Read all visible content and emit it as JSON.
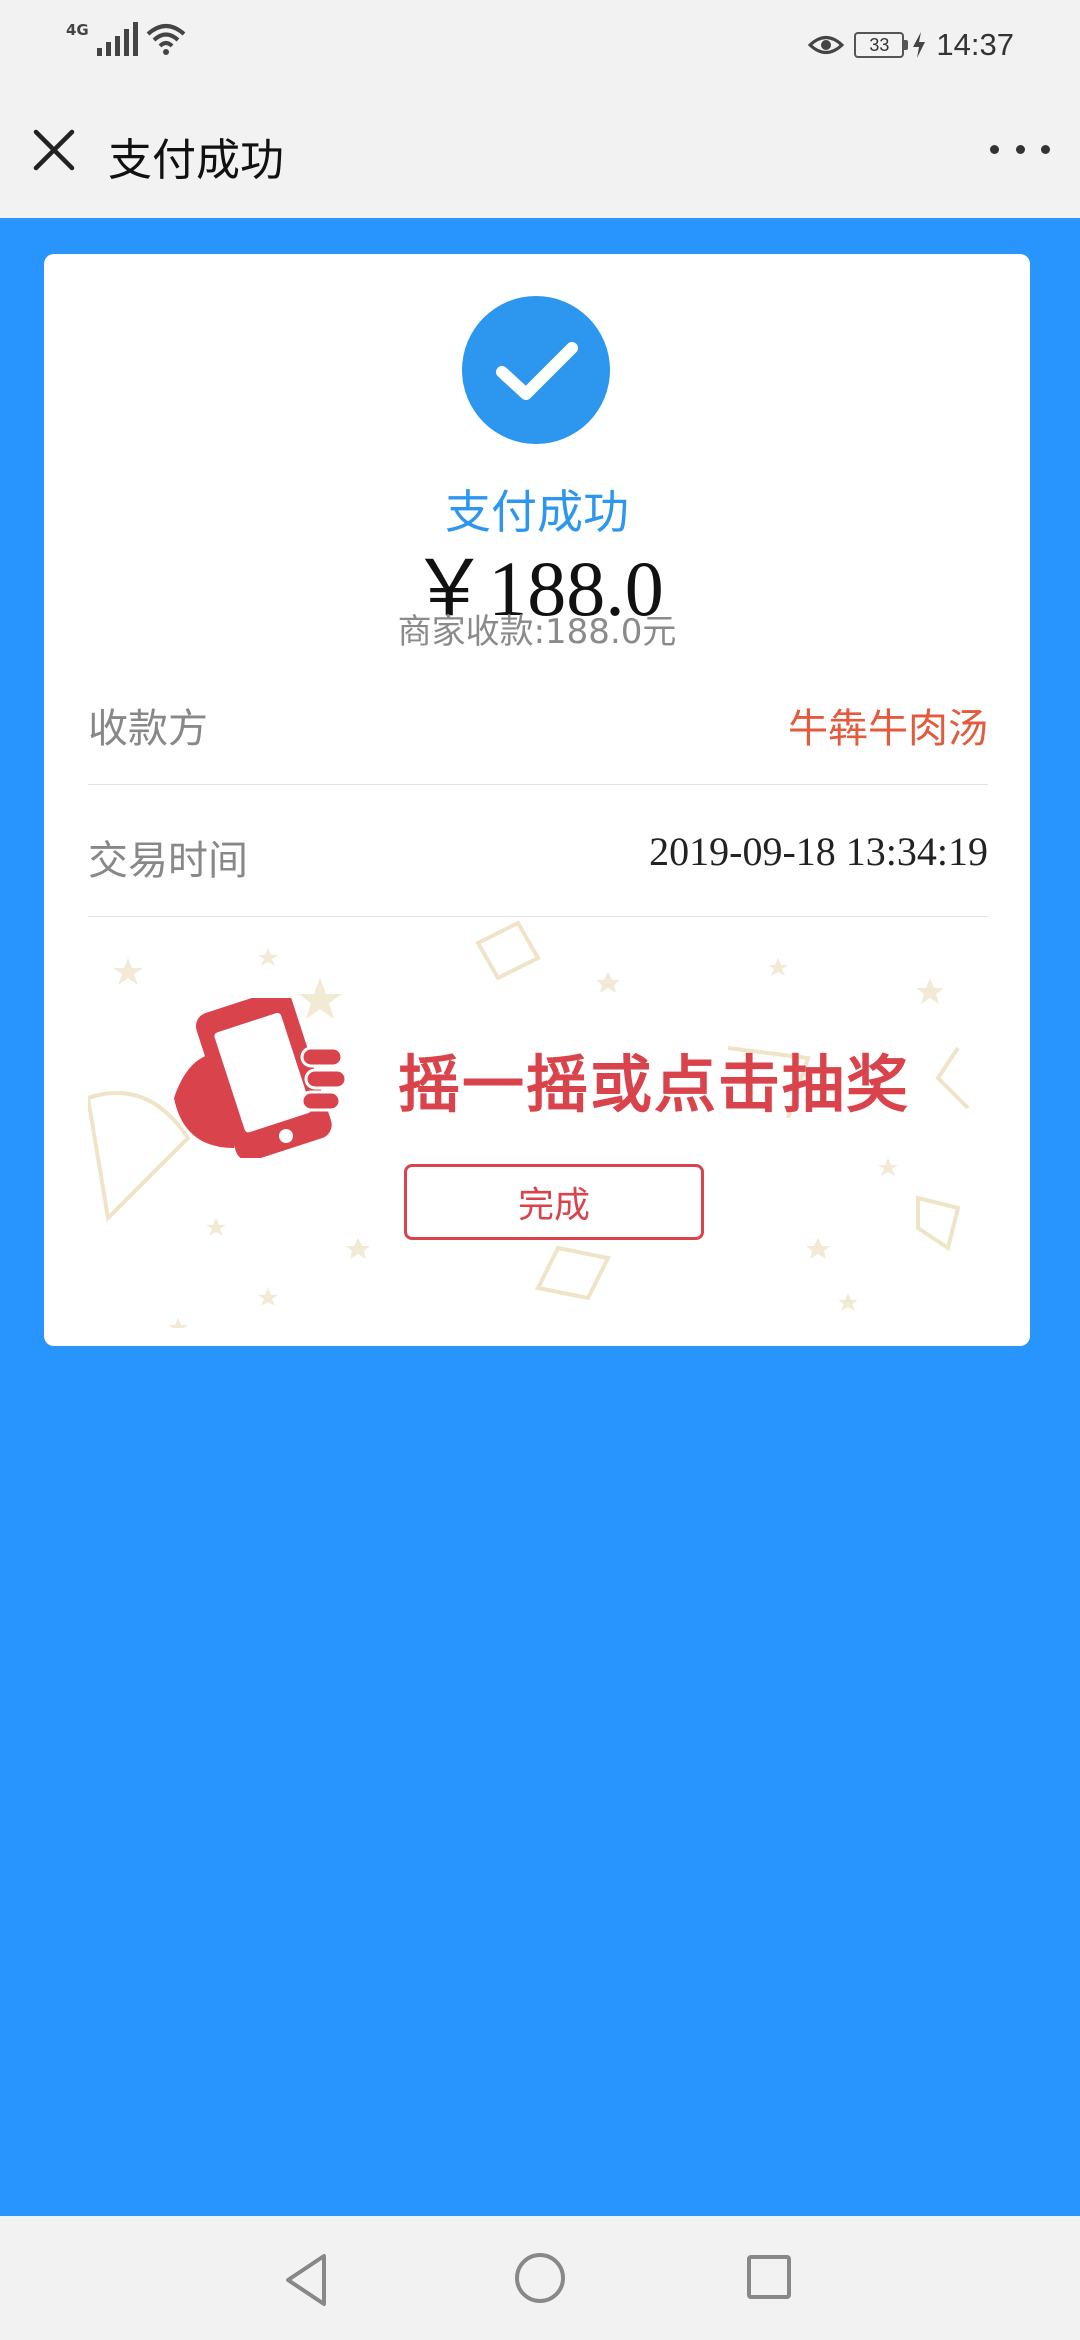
{
  "status_bar": {
    "network": "4G",
    "battery": "33",
    "time": "14:37"
  },
  "title_bar": {
    "title": "支付成功"
  },
  "receipt": {
    "status": "支付成功",
    "amount": "￥188.0",
    "merchant_received": "商家收款:188.0元",
    "rows": [
      {
        "label": "收款方",
        "value": "牛犇牛肉汤"
      },
      {
        "label": "交易时间",
        "value": "2019-09-18 13:34:19"
      }
    ]
  },
  "promo": {
    "text": "摇一摇或点击抽奖",
    "done_label": "完成"
  },
  "colors": {
    "primary_blue": "#2895ff",
    "check_blue": "#2d96ee",
    "payee_red": "#e35a3c",
    "promo_red": "#d9434b"
  },
  "icons": [
    "close-icon",
    "more-icon",
    "check-icon",
    "shake-phone-icon",
    "back-icon",
    "home-icon",
    "recent-apps-icon"
  ]
}
